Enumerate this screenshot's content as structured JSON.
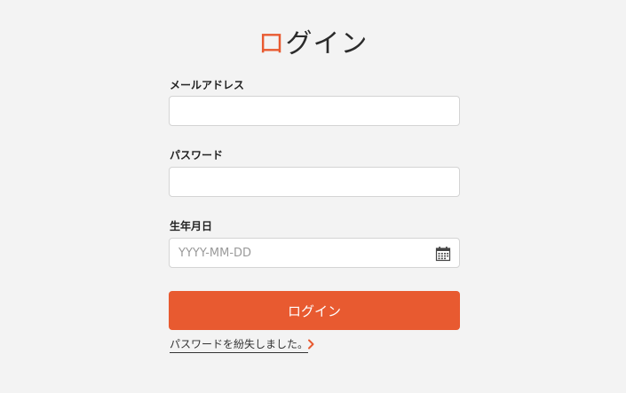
{
  "title": {
    "accent_char": "ロ",
    "rest": "グイン"
  },
  "form": {
    "email_label": "メールアドレス",
    "email_value": "",
    "password_label": "パスワード",
    "password_value": "",
    "birthdate_label": "生年月日",
    "birthdate_placeholder": "YYYY-MM-DD",
    "birthdate_icon": "calendar-icon",
    "submit_label": "ログイン"
  },
  "forgot_link": {
    "text": "パスワードを紛失しました。",
    "icon": "chevron-right-icon"
  },
  "colors": {
    "accent": "#e85a30",
    "background": "#f3f3f3"
  }
}
